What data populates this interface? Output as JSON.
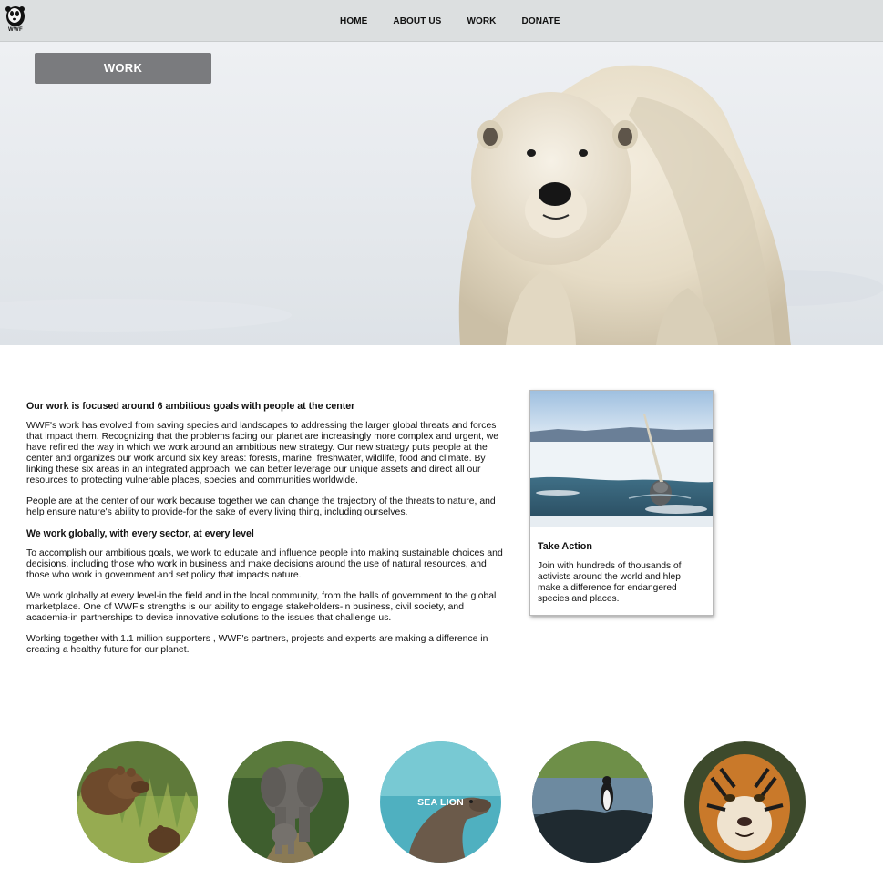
{
  "brand": {
    "logo_text": "WWF"
  },
  "nav": {
    "items": [
      "HOME",
      "ABOUT US",
      "WORK",
      "DONATE"
    ]
  },
  "hero": {
    "badge": "WORK"
  },
  "content": {
    "heading1": "Our work is focused around 6 ambitious goals with people at the center",
    "p1": "WWF's work has evolved from saving species and landscapes to addressing the larger global threats and forces that impact them. Recognizing that the problems facing our planet are increasingly more complex and urgent, we have refined the way in which we work around an ambitious new strategy. Our new strategy puts people at the center and organizes our work around six key areas: forests, marine, freshwater, wildlife, food and climate. By linking these six areas in an integrated approach, we can better leverage our unique assets and direct all our resources to protecting vulnerable places, species and communities worldwide.",
    "p2": "People are at the center of our work because together we can change the trajectory of the threats to nature, and help ensure nature's ability to provide-for the sake of every living thing, including ourselves.",
    "heading2": "We work globally, with every sector, at every level",
    "p3": "To accomplish our ambitious goals, we work to educate and influence people into making sustainable choices and decisions, including those who work in business and make decisions around the use of natural resources, and those who work in government and set policy that impacts nature.",
    "p4": "We work globally at every level-in the field and in the local community, from the halls of government to the global marketplace. One of WWF's strengths is our ability to engage stakeholders-in business, civil society, and academia-in partnerships to devise innovative solutions to the issues that challenge us.",
    "p5": "Working together with 1.1 million supporters , WWF's partners, projects and experts are making a difference in creating a healthy future for our planet."
  },
  "card": {
    "title": "Take Action",
    "body": "Join with hundreds of thousands of activists around the world and hlep make a difference for endangered species and places."
  },
  "animals": {
    "sea_lion_label": "SEA LION"
  }
}
